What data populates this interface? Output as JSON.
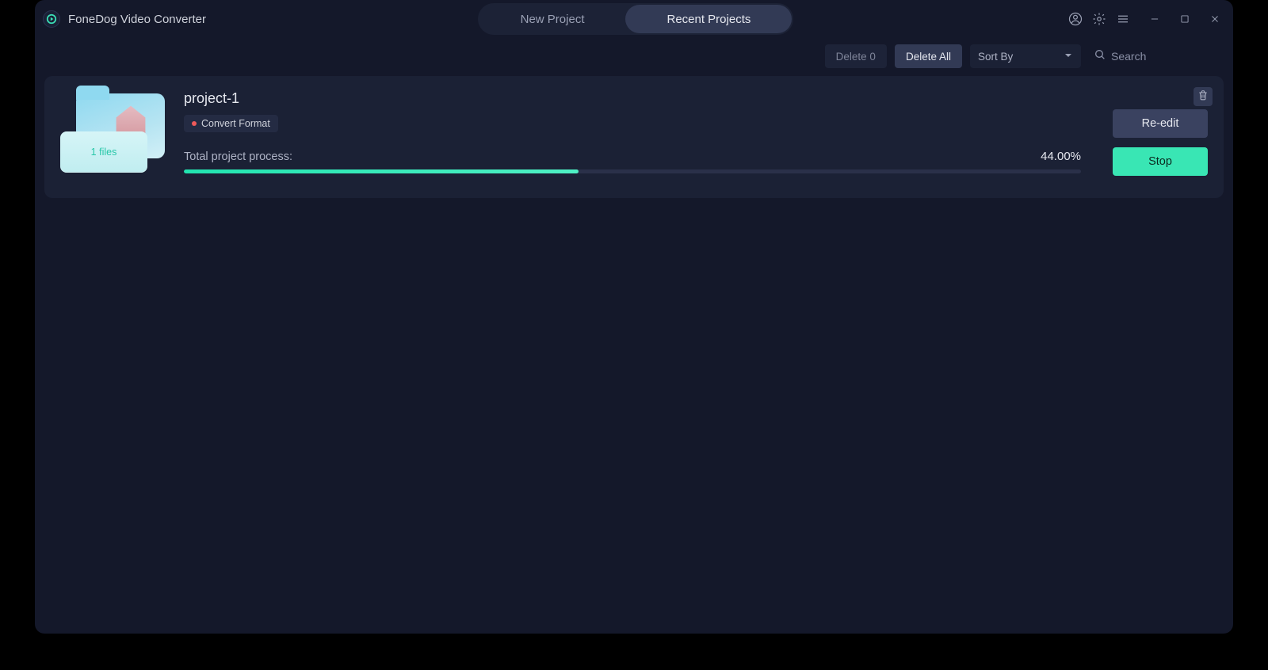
{
  "app": {
    "title": "FoneDog Video Converter"
  },
  "tabs": {
    "new_project": "New Project",
    "recent_projects": "Recent Projects"
  },
  "toolbar": {
    "delete_count_label": "Delete 0",
    "delete_all_label": "Delete All",
    "sort_by_label": "Sort By",
    "search_placeholder": "Search"
  },
  "project": {
    "name": "project-1",
    "tag_label": "Convert Format",
    "thumb_badge": "1 files",
    "progress_label": "Total project process:",
    "progress_pct_text": "44.00%",
    "progress_pct_value": 44,
    "reedit_label": "Re-edit",
    "stop_label": "Stop"
  }
}
